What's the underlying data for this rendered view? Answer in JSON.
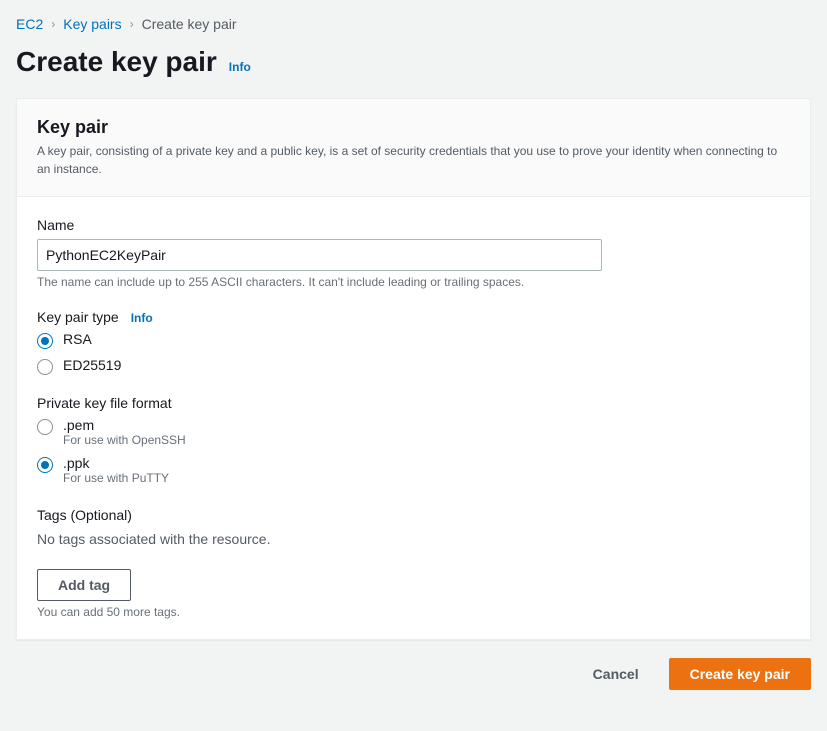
{
  "breadcrumb": {
    "items": [
      {
        "label": "EC2",
        "link": true
      },
      {
        "label": "Key pairs",
        "link": true
      },
      {
        "label": "Create key pair",
        "link": false
      }
    ]
  },
  "page": {
    "title": "Create key pair",
    "info": "Info"
  },
  "panel": {
    "title": "Key pair",
    "description": "A key pair, consisting of a private key and a public key, is a set of security credentials that you use to prove your identity when connecting to an instance."
  },
  "form": {
    "name": {
      "label": "Name",
      "value": "PythonEC2KeyPair",
      "hint": "The name can include up to 255 ASCII characters. It can't include leading or trailing spaces."
    },
    "type": {
      "label": "Key pair type",
      "info": "Info",
      "options": [
        {
          "label": "RSA",
          "checked": true
        },
        {
          "label": "ED25519",
          "checked": false
        }
      ]
    },
    "format": {
      "label": "Private key file format",
      "options": [
        {
          "label": ".pem",
          "desc": "For use with OpenSSH",
          "checked": false
        },
        {
          "label": ".ppk",
          "desc": "For use with PuTTY",
          "checked": true
        }
      ]
    },
    "tags": {
      "label": "Tags (Optional)",
      "empty": "No tags associated with the resource.",
      "add_button": "Add tag",
      "hint": "You can add 50 more tags."
    }
  },
  "actions": {
    "cancel": "Cancel",
    "submit": "Create key pair"
  }
}
